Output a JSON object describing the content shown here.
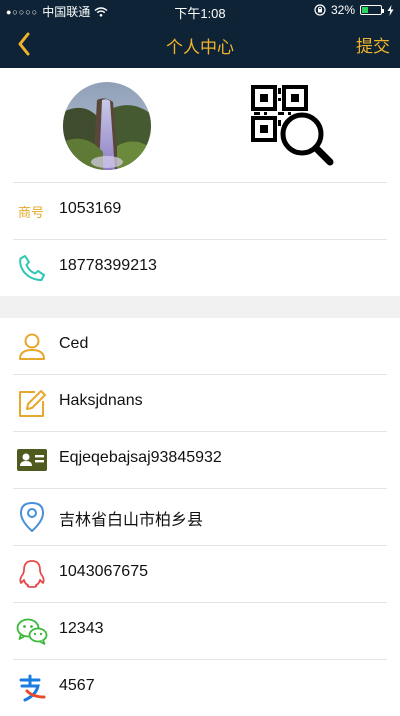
{
  "status_bar": {
    "carrier": "中国联通",
    "time": "下午1:08",
    "battery": "32%",
    "battery_level": 0.32
  },
  "nav": {
    "title": "个人中心",
    "submit_label": "提交",
    "back_icon": "chevron-left-icon"
  },
  "colors": {
    "header_bg": "#0e2436",
    "accent": "#f2b32a"
  },
  "merchant": {
    "label": "商号",
    "number": "1053169"
  },
  "phone": {
    "icon": "phone-icon",
    "value": "18778399213"
  },
  "profile": {
    "name": "Ced",
    "nickname": "Haksjdnans",
    "id_card": "Eqjeqebajsaj93845932",
    "address": "吉林省白山市柏乡县",
    "qq": "1043067675",
    "wechat": "12343",
    "alipay": "4567"
  }
}
